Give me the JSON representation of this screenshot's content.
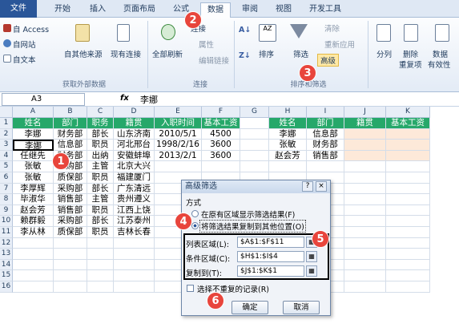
{
  "tabs": [
    "文件",
    "开始",
    "插入",
    "页面布局",
    "公式",
    "数据",
    "审阅",
    "视图",
    "开发工具"
  ],
  "ribbon": {
    "access": "自 Access",
    "web": "自网站",
    "text": "自文本",
    "other": "自其他来源",
    "existing": "现有连接",
    "group_external": "获取外部数据",
    "refresh": "全部刷新",
    "connections": "连接",
    "properties": "属性",
    "edit_links": "编辑链接",
    "group_conn": "连接",
    "sort": "排序",
    "filter": "筛选",
    "clear": "清除",
    "reapply": "重新应用",
    "advanced": "高级",
    "group_sort": "排序和筛选",
    "split": "分列",
    "remove_dup_1": "删除",
    "remove_dup_2": "重复项",
    "valid_1": "数据",
    "valid_2": "有效性"
  },
  "formula_bar": {
    "name_box": "A3",
    "fx": "fx",
    "value": "李娜"
  },
  "columns": [
    "A",
    "B",
    "C",
    "D",
    "E",
    "F",
    "G",
    "H",
    "I",
    "J",
    "K"
  ],
  "rows": [
    "1",
    "2",
    "3",
    "4",
    "5",
    "6",
    "7",
    "8",
    "9",
    "10",
    "11",
    "12",
    "13",
    "14",
    "15",
    "16"
  ],
  "table": {
    "headers": [
      "姓名",
      "部门",
      "职务",
      "籍贯",
      "入职时间",
      "基本工资"
    ],
    "rows": [
      [
        "李娜",
        "财务部",
        "部长",
        "山东济南",
        "2010/5/1",
        "4500"
      ],
      [
        "李娜",
        "信息部",
        "职员",
        "河北邢台",
        "1998/2/16",
        "3600"
      ],
      [
        "任继先",
        "财务部",
        "出纳",
        "安徽蚌埠",
        "2013/2/1",
        "3600"
      ],
      [
        "张敏",
        "采购部",
        "主管",
        "北京大兴",
        "",
        ""
      ],
      [
        "张敏",
        "质保部",
        "职员",
        "福建厦门",
        "",
        ""
      ],
      [
        "李厚辉",
        "采购部",
        "部长",
        "广东清远",
        "",
        ""
      ],
      [
        "毕淑华",
        "销售部",
        "主管",
        "贵州遵义",
        "",
        ""
      ],
      [
        "赵会芳",
        "销售部",
        "职员",
        "江西上饶",
        "",
        ""
      ],
      [
        "赖群毅",
        "采购部",
        "部长",
        "江苏泰州",
        "",
        ""
      ],
      [
        "李从林",
        "质保部",
        "职员",
        "吉林长春",
        "",
        ""
      ]
    ]
  },
  "criteria": {
    "headers": [
      "姓名",
      "部门",
      "籍贯",
      "基本工资"
    ],
    "rows": [
      [
        "李娜",
        "信息部"
      ],
      [
        "张敏",
        "财务部"
      ],
      [
        "赵会芳",
        "销售部"
      ]
    ]
  },
  "dialog": {
    "title": "高级筛选",
    "help": "?",
    "close": "×",
    "mode_label": "方式",
    "opt_inplace": "在原有区域显示筛选结果(F)",
    "opt_copy": "将筛选结果复制到其他位置(O)",
    "list_label": "列表区域(L):",
    "list_value": "$A$1:$F$11",
    "crit_label": "条件区域(C):",
    "crit_value": "$H$1:$I$4",
    "copy_label": "复制到(T):",
    "copy_value": "$J$1:$K$1",
    "unique_label": "选择不重复的记录(R)",
    "ok": "确定",
    "cancel": "取消"
  },
  "badges": [
    "1",
    "2",
    "3",
    "4",
    "5",
    "6"
  ],
  "colors": {
    "header_green": "#26a86a",
    "criteria_pink": "#fde9d9",
    "badge_red": "#e8453c",
    "file_tab": "#2a5699"
  }
}
